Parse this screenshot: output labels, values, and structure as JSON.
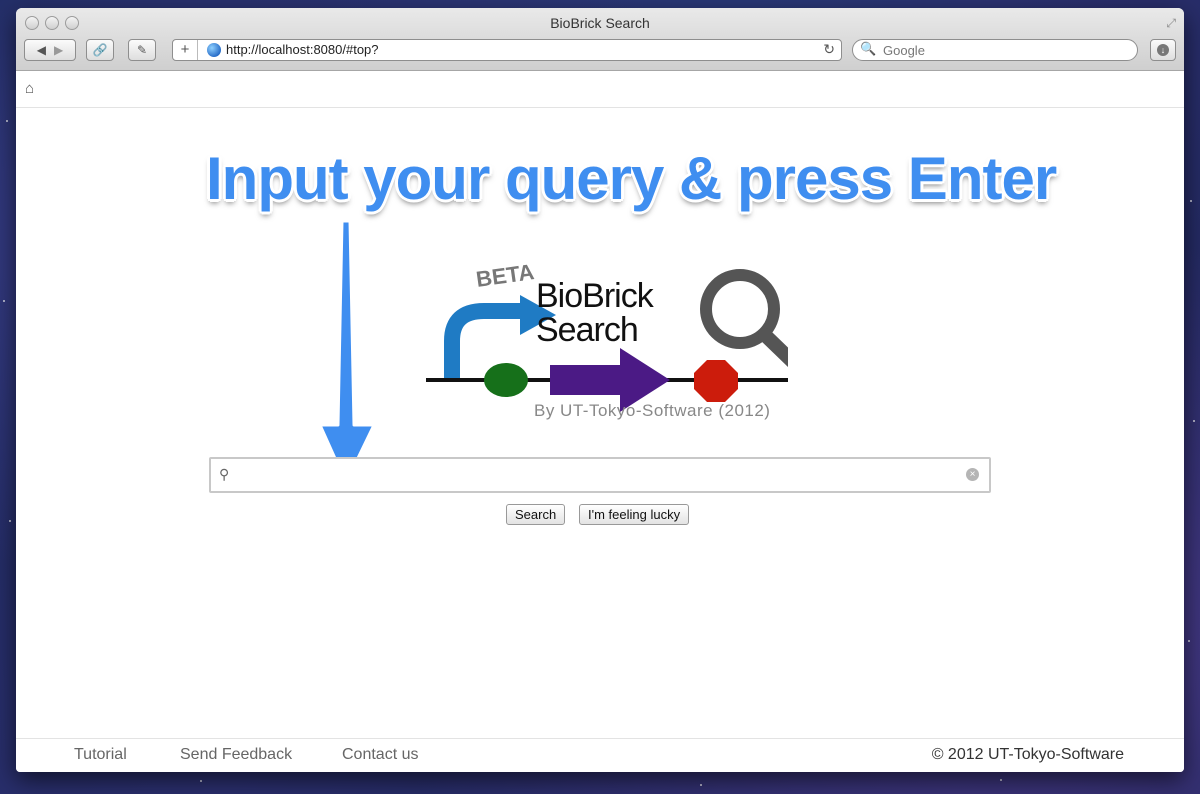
{
  "window": {
    "title": "BioBrick Search"
  },
  "address_bar": {
    "url": "http://localhost:8080/#top?"
  },
  "web_search": {
    "placeholder": "Google"
  },
  "annotation": {
    "text": "Input your query & press Enter"
  },
  "logo": {
    "beta": "BETA",
    "line1": "BioBrick",
    "line2": "Search",
    "byline": "By UT-Tokyo-Software (2012)"
  },
  "search": {
    "value": ""
  },
  "buttons": {
    "search": "Search",
    "lucky": "I'm feeling lucky"
  },
  "footer": {
    "links": [
      "Tutorial",
      "Send Feedback",
      "Contact us"
    ],
    "copyright": "© 2012 UT-Tokyo-Software"
  },
  "colors": {
    "annotation_blue": "#3f8ef0",
    "arrow_blue": "#1f7bc4",
    "promoter_green": "#16701a",
    "cds_purple": "#4b1a85",
    "terminator_red": "#cc1c0c",
    "magnifier_gray": "#555555"
  }
}
